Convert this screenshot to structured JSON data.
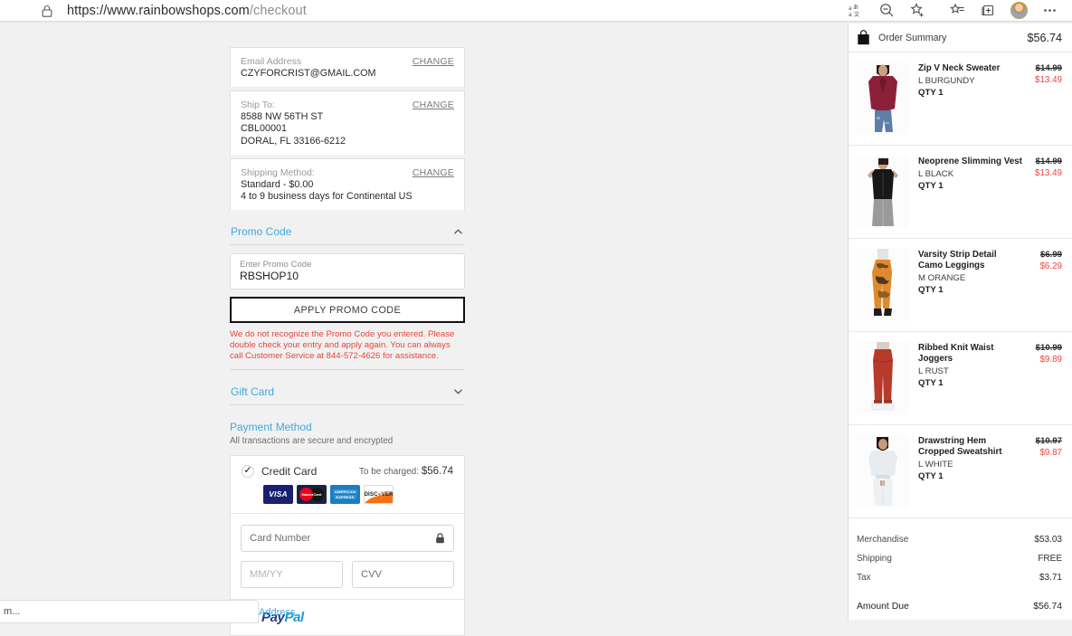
{
  "browser": {
    "url_scheme": "https://www.rainbowshops.com",
    "url_path": "/checkout",
    "lock_icon": "lock-icon",
    "toolbar_icons": [
      {
        "name": "translate-icon",
        "glyph": "文A"
      },
      {
        "name": "zoom-out-icon",
        "glyph": "search-minus"
      },
      {
        "name": "add-favorite-icon",
        "glyph": "star-plus"
      },
      {
        "name": "favorites-list-icon",
        "glyph": "star-lines"
      },
      {
        "name": "collections-icon",
        "glyph": "stack-plus"
      },
      {
        "name": "profile-avatar",
        "glyph": "avatar"
      },
      {
        "name": "settings-more-icon",
        "glyph": "…"
      }
    ]
  },
  "checkout": {
    "email": {
      "label": "Email Address",
      "value": "CZYFORCRIST@GMAIL.COM",
      "change": "CHANGE"
    },
    "ship_to": {
      "label": "Ship To:",
      "line1": "8588 NW 56TH ST",
      "line2": "CBL00001",
      "line3": "DORAL, FL 33166-6212",
      "change": "CHANGE"
    },
    "shipping_method": {
      "label": "Shipping Method:",
      "line1": "Standard - $0.00",
      "line2": "4 to 9 business days for Continental US",
      "change": "CHANGE"
    },
    "promo": {
      "section_title": "Promo Code",
      "input_label": "Enter Promo Code",
      "input_value": "RBSHOP10",
      "apply_label": "APPLY PROMO CODE",
      "error": "We do not recognize the Promo Code you entered. Please double check your entry and apply again. You can always call Customer Service at 844-572-4626 for assistance."
    },
    "gift_card": {
      "section_title": "Gift Card"
    },
    "payment": {
      "title": "Payment Method",
      "subtitle": "All transactions are secure and encrypted",
      "credit_card_label": "Credit Card",
      "charge_prefix": "To be charged:",
      "charge_amount": "$56.74",
      "card_logos": [
        "VISA",
        "MasterCard",
        "AMERICAN EXPRESS",
        "DISCOVER"
      ],
      "card_number_placeholder": "Card Number",
      "expiry_placeholder": "MM/YY",
      "cvv_placeholder": "CVV",
      "paypal_label": "PayPal"
    },
    "bottom_bar": {
      "input_text": "m...",
      "address_link": "Address"
    }
  },
  "order_summary": {
    "title": "Order Summary",
    "total": "$56.74",
    "items": [
      {
        "name": "Zip V Neck Sweater",
        "attributes": "L  BURGUNDY",
        "qty": "QTY 1",
        "price_original": "$14.99",
        "price_sale": "$13.49",
        "thumb": "burgundy-sweater"
      },
      {
        "name": "Neoprene Slimming Vest",
        "attributes": "L  BLACK",
        "qty": "QTY 1",
        "price_original": "$14.99",
        "price_sale": "$13.49",
        "thumb": "black-vest"
      },
      {
        "name": "Varsity Strip Detail Camo Leggings",
        "attributes": "M  ORANGE",
        "qty": "QTY 1",
        "price_original": "$6.99",
        "price_sale": "$6.29",
        "thumb": "camo-leggings"
      },
      {
        "name": "Ribbed Knit Waist Joggers",
        "attributes": "L  RUST",
        "qty": "QTY 1",
        "price_original": "$10.99",
        "price_sale": "$9.89",
        "thumb": "rust-joggers"
      },
      {
        "name": "Drawstring Hem Cropped Sweatshirt",
        "attributes": "L  WHITE",
        "qty": "QTY 1",
        "price_original": "$10.97",
        "price_sale": "$9.87",
        "thumb": "white-sweatshirt"
      }
    ],
    "totals": [
      {
        "label": "Merchandise",
        "value": "$53.03"
      },
      {
        "label": "Shipping",
        "value": "FREE"
      },
      {
        "label": "Tax",
        "value": "$3.71"
      }
    ],
    "amount_due": {
      "label": "Amount Due",
      "value": "$56.74"
    }
  },
  "colors": {
    "accent_blue": "#3fa9e0",
    "error_red": "#e8453c",
    "sale_red": "#e8453c",
    "page_bg": "#f1f1f1"
  }
}
